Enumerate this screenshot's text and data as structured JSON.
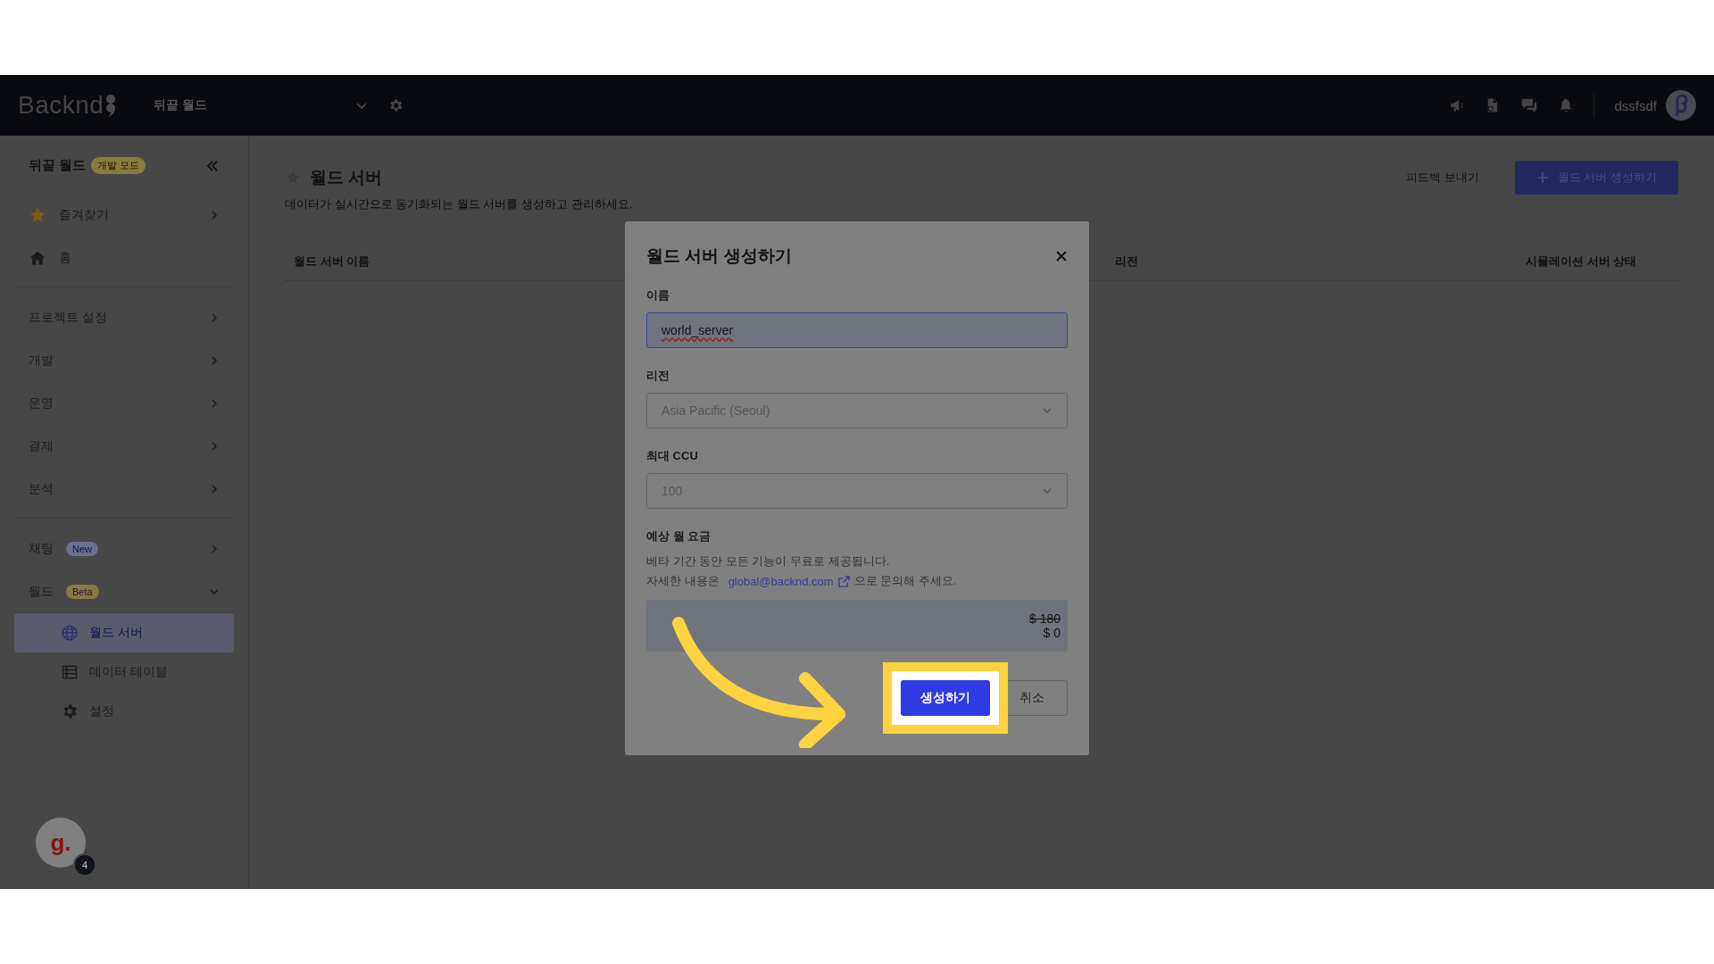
{
  "topbar": {
    "logo": "Backnd",
    "project": "뒤끝 월드",
    "user": "dssfsdf"
  },
  "sidebar": {
    "title": "뒤끝 월드",
    "badge": {
      "text": "개발 모드",
      "color": "#8a7a40"
    },
    "groups": [
      [
        {
          "kind": "favorites",
          "label": "즐겨찾기",
          "expanded": false
        },
        {
          "kind": "home",
          "label": "홈"
        }
      ],
      [
        {
          "kind": "menu",
          "label": "프로젝트 설정",
          "expanded": false
        },
        {
          "kind": "menu",
          "label": "개발",
          "expanded": false
        },
        {
          "kind": "menu",
          "label": "운영",
          "expanded": false
        },
        {
          "kind": "menu",
          "label": "결제",
          "expanded": false
        },
        {
          "kind": "menu",
          "label": "분석",
          "expanded": false
        }
      ],
      [
        {
          "kind": "menu",
          "label": "채팅",
          "badge": {
            "text": "New",
            "color": "#6a7090"
          },
          "expanded": false
        },
        {
          "kind": "menu",
          "label": "월드",
          "badge": {
            "text": "Beta",
            "color": "#8a7a40"
          },
          "expanded": true,
          "children": [
            {
              "kind": "globe",
              "label": "월드 서버",
              "selected": true
            },
            {
              "kind": "table",
              "label": "데이터 테이블",
              "selected": false
            },
            {
              "kind": "gear",
              "label": "설정",
              "selected": false
            }
          ]
        }
      ]
    ]
  },
  "chat_widget": {
    "logo": "g.",
    "count": "4"
  },
  "main": {
    "title": "월드 서버",
    "subtitle": "데이터가 실시간으로 동기화되는 월드 서버를 생성하고 관리하세요.",
    "feedback": "피드백 보내기",
    "create_button": "월드 서버 생성하기",
    "table": {
      "columns": [
        "월드 서버 이름",
        "리전",
        "시뮬레이션 서버 상태"
      ]
    }
  },
  "modal": {
    "title": "월드 서버 생성하기",
    "fields": [
      {
        "kind": "text",
        "label": "이름",
        "value": "world_server"
      },
      {
        "kind": "select",
        "label": "리전",
        "value": "Asia Pacific (Seoul)"
      },
      {
        "kind": "select",
        "label": "최대 CCU",
        "value": "100"
      }
    ],
    "cost": {
      "label": "예상 월 요금",
      "note": "베타 기간 동안 모든 기능이 무료로 제공됩니다.",
      "contact_prefix": "자세한 내용은",
      "link": "global@backnd.com",
      "contact_suffix": "으로 문의해 주세요.",
      "old_price": "$ 180",
      "price": "$ 0"
    },
    "buttons": [
      {
        "kind": "primary",
        "label": "생성하기",
        "highlighted": true
      },
      {
        "kind": "secondary",
        "label": "취소",
        "highlighted": false
      }
    ]
  }
}
